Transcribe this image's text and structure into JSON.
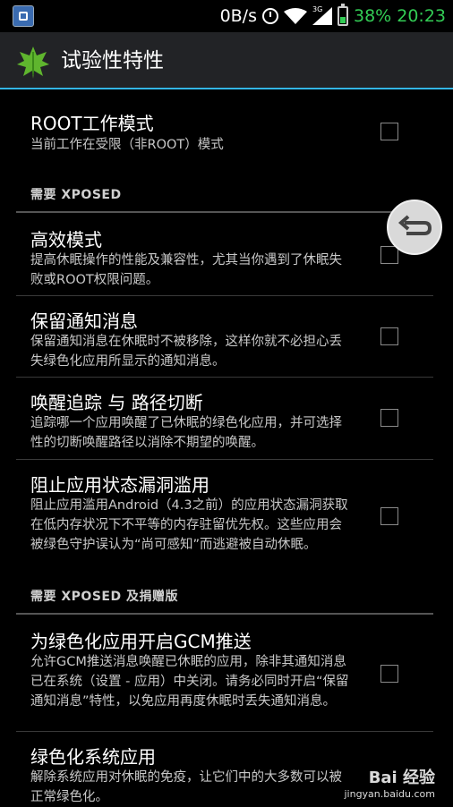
{
  "status_bar": {
    "speed": "0B/s",
    "network": "3G",
    "battery_percent": "38%",
    "time": "20:23",
    "icons": [
      "notification-app-icon",
      "alarm-icon",
      "wifi-icon",
      "signal-icon",
      "battery-icon"
    ]
  },
  "action_bar": {
    "title": "试验性特性",
    "icon": "leaf-logo-icon"
  },
  "preferences": [
    {
      "title": "ROOT工作模式",
      "summary": "当前工作在受限（非ROOT）模式",
      "checked": false
    },
    {
      "header": "需要 XPOSED"
    },
    {
      "title": "高效模式",
      "summary": "提高休眠操作的性能及兼容性，尤其当你遇到了休眠失败或ROOT权限问题。",
      "checked": false
    },
    {
      "title": "保留通知消息",
      "summary": "保留通知消息在休眠时不被移除，这样你就不必担心丢失绿色化应用所显示的通知消息。",
      "checked": false
    },
    {
      "title": "唤醒追踪 与 路径切断",
      "summary": "追踪哪一个应用唤醒了已休眠的绿色化应用，并可选择性的切断唤醒路径以消除不期望的唤醒。",
      "checked": false
    },
    {
      "title": "阻止应用状态漏洞滥用",
      "summary": "阻止应用滥用Android（4.3之前）的应用状态漏洞获取在低内存状况下不平等的内存驻留优先权。这些应用会被绿色守护误认为“尚可感知”而逃避被自动休眠。",
      "checked": false
    },
    {
      "header": "需要 XPOSED 及捐赠版"
    },
    {
      "title": "为绿色化应用开启GCM推送",
      "summary": "允许GCM推送消息唤醒已休眠的应用，除非其通知消息已在系统（设置 - 应用）中关闭。请务必同时开启“保留通知消息”特性，以免应用再度休眠时丢失通知消息。",
      "checked": false
    },
    {
      "title": "绿色化系统应用",
      "summary": "解除系统应用对休眠的免疫，让它们中的大多数可以被正常绿色化。"
    }
  ],
  "overlay": {
    "back_button_icon": "back-arrow-icon"
  },
  "watermark": {
    "main": "Bai 经验",
    "sub": "jingyan.baidu.com"
  },
  "colors": {
    "accent": "#33b5e5",
    "status_green": "#33cc55",
    "background": "#000000"
  }
}
